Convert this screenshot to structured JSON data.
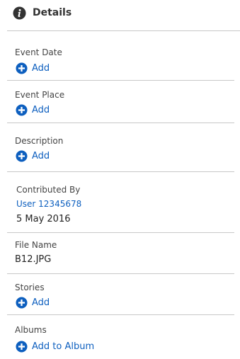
{
  "header": {
    "title": "Details",
    "icon": "info-icon"
  },
  "sections": {
    "event_date": {
      "label": "Event Date",
      "action": "Add",
      "icon": "plus-circle-icon"
    },
    "event_place": {
      "label": "Event Place",
      "action": "Add",
      "icon": "plus-circle-icon"
    },
    "description": {
      "label": "Description",
      "action": "Add",
      "icon": "plus-circle-icon"
    },
    "contributed_by": {
      "label": "Contributed By",
      "user": "User 12345678",
      "date": "5 May 2016"
    },
    "file_name": {
      "label": "File Name",
      "value": "B12.JPG"
    },
    "stories": {
      "label": "Stories",
      "action": "Add",
      "icon": "plus-circle-icon"
    },
    "albums": {
      "label": "Albums",
      "action": "Add to Album",
      "icon": "plus-circle-icon"
    }
  },
  "colors": {
    "accent": "#0d5fbf",
    "divider": "#c8c8c8",
    "text": "#333333",
    "icon_dark": "#333333"
  }
}
